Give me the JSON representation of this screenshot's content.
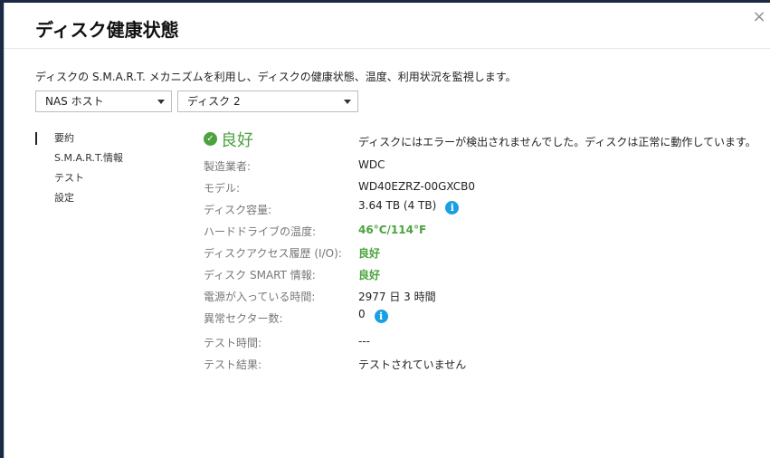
{
  "dialog": {
    "title": "ディスク健康状態",
    "close_symbol": "×",
    "description": "ディスクの S.M.A.R.T. メカニズムを利用し、ディスクの健康状態、温度、利用状況を監視します。"
  },
  "selectors": {
    "host": "NAS ホスト",
    "disk": "ディスク 2"
  },
  "nav": {
    "items": [
      {
        "label": "要約",
        "active": true
      },
      {
        "label": "S.M.A.R.T.情報",
        "active": false
      },
      {
        "label": "テスト",
        "active": false
      },
      {
        "label": "設定",
        "active": false
      }
    ]
  },
  "summary": {
    "status_icon": "check-circle-icon",
    "status_symbol": "✓",
    "status": "良好",
    "status_message": "ディスクにはエラーが検出されませんでした。ディスクは正常に動作しています。",
    "rows": [
      {
        "label": "製造業者:",
        "value": "WDC"
      },
      {
        "label": "モデル:",
        "value": "WD40EZRZ-00GXCB0"
      },
      {
        "label": "ディスク容量:",
        "value": "3.64 TB (4 TB)"
      },
      {
        "label": "ハードドライブの温度:",
        "value": "46°C/114°F"
      },
      {
        "label": "ディスクアクセス履歴 (I/O):",
        "value": "良好"
      },
      {
        "label": "ディスク SMART 情報:",
        "value": "良好"
      },
      {
        "label": "電源が入っている時間:",
        "value": "2977 日 3 時間"
      },
      {
        "label": "異常セクター数:",
        "value": "0"
      },
      {
        "label": "テスト時間:",
        "value": "---"
      },
      {
        "label": "テスト結果:",
        "value": "テストされていません"
      }
    ],
    "info_symbol": "i"
  },
  "colors": {
    "good_green": "#4ba33e",
    "info_blue": "#1a9fe3",
    "background": "#1b2a44"
  }
}
